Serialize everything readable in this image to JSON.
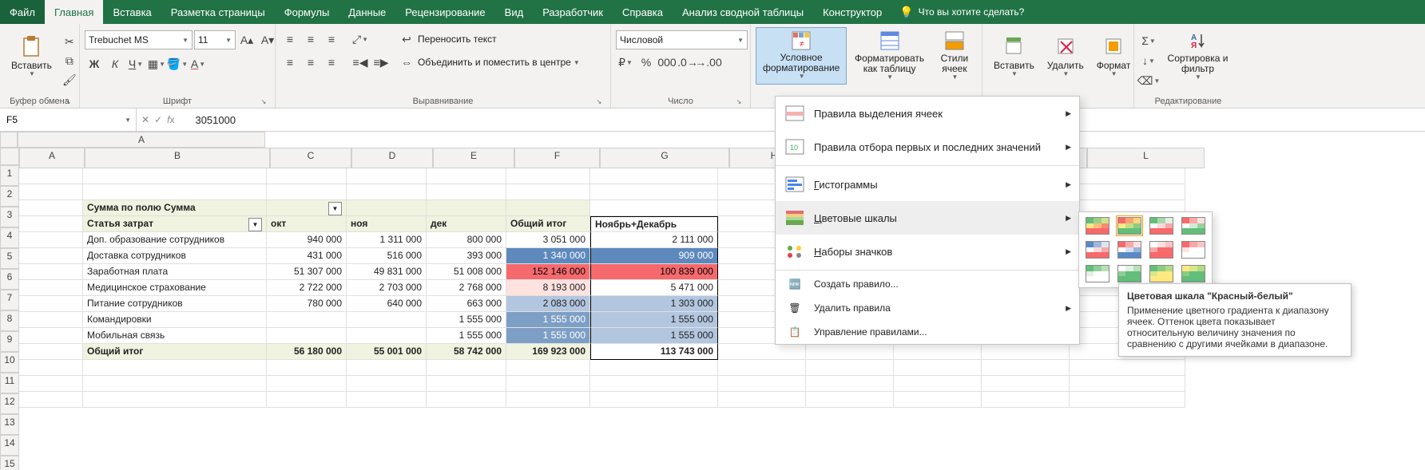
{
  "tabs": [
    "Файл",
    "Главная",
    "Вставка",
    "Разметка страницы",
    "Формулы",
    "Данные",
    "Рецензирование",
    "Вид",
    "Разработчик",
    "Справка",
    "Анализ сводной таблицы",
    "Конструктор"
  ],
  "active_tab": "Главная",
  "tellme": "Что вы хотите сделать?",
  "groups": {
    "clipboard": {
      "paste": "Вставить",
      "label": "Буфер обмена"
    },
    "font": {
      "family": "Trebuchet MS",
      "size": "11",
      "bold": "Ж",
      "italic": "К",
      "underline": "Ч",
      "label": "Шрифт"
    },
    "align": {
      "wrap": "Переносить текст",
      "merge": "Объединить и поместить в центре",
      "label": "Выравнивание"
    },
    "number": {
      "format": "Числовой",
      "label": "Число"
    },
    "styles": {
      "cond": "Условное форматирование",
      "fmt_table": "Форматировать как таблицу",
      "cell_styles": "Стили ячеек"
    },
    "cells": {
      "insert": "Вставить",
      "delete": "Удалить",
      "format": "Формат"
    },
    "editing": {
      "sort": "Сортировка и фильтр",
      "label": "Редактирование"
    }
  },
  "formula_bar": {
    "cell": "F5",
    "value": "3051000"
  },
  "columns": [
    "A",
    "B",
    "C",
    "D",
    "E",
    "F",
    "G",
    "H",
    "I",
    "J",
    "K",
    "L"
  ],
  "pivot": {
    "sum_label": "Сумма по полю Сумма",
    "row_header": "Статья затрат",
    "cols": [
      "окт",
      "ноя",
      "дек",
      "Общий итог"
    ],
    "extra_col": "Ноябрь+Декабрь",
    "rows": [
      {
        "name": "Доп. образование сотрудников",
        "vals": [
          "940 000",
          "1 311 000",
          "800 000",
          "3 051 000",
          "2 111 000"
        ]
      },
      {
        "name": "Доставка сотрудников",
        "vals": [
          "431 000",
          "516 000",
          "393 000",
          "1 340 000",
          "909 000"
        ]
      },
      {
        "name": "Заработная плата",
        "vals": [
          "51 307 000",
          "49 831 000",
          "51 008 000",
          "152 146 000",
          "100 839 000"
        ]
      },
      {
        "name": "Медицинское страхование",
        "vals": [
          "2 722 000",
          "2 703 000",
          "2 768 000",
          "8 193 000",
          "5 471 000"
        ]
      },
      {
        "name": "Питание сотрудников",
        "vals": [
          "780 000",
          "640 000",
          "663 000",
          "2 083 000",
          "1 303 000"
        ]
      },
      {
        "name": "Командировки",
        "vals": [
          "",
          "",
          "1 555 000",
          "1 555 000",
          "1 555 000"
        ]
      },
      {
        "name": "Мобильная связь",
        "vals": [
          "",
          "",
          "1 555 000",
          "1 555 000",
          "1 555 000"
        ]
      }
    ],
    "total": {
      "name": "Общий итог",
      "vals": [
        "56 180 000",
        "55 001 000",
        "58 742 000",
        "169 923 000",
        "113 743 000"
      ]
    }
  },
  "cf_menu": {
    "highlight": "Правила выделения ячеек",
    "top": "Правила отбора первых и последних значений",
    "bars": "Гистограммы",
    "scales": "Цветовые шкалы",
    "icons": "Наборы значков",
    "new": "Создать правило...",
    "clear": "Удалить правила",
    "manage": "Управление правилами..."
  },
  "tooltip": {
    "title": "Цветовая шкала \"Красный-белый\"",
    "body": "Применение цветного градиента к диапазону ячеек. Оттенок цвета показывает относительную величину значения по сравнению с другими ячейками в диапазоне."
  }
}
